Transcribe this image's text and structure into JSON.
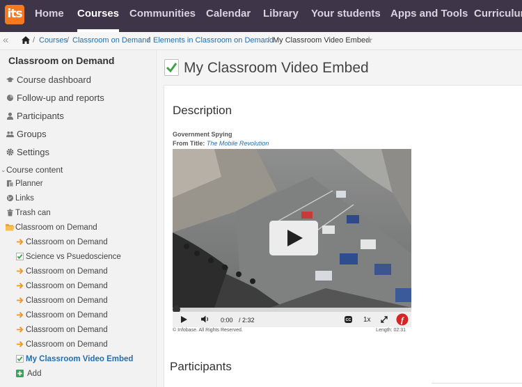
{
  "topnav": {
    "logo": "its",
    "items": [
      "Home",
      "Courses",
      "Communities",
      "Calendar",
      "Library",
      "Your students",
      "Apps and Tools",
      "Curriculum"
    ],
    "active": "Courses"
  },
  "breadcrumb": {
    "items": [
      "Courses",
      "Classroom on Demand",
      "Elements in Classroom on Demand"
    ],
    "current": "My Classroom Video Embed",
    "separator": "/"
  },
  "sidebar": {
    "title": "Classroom on Demand",
    "nav": [
      {
        "label": "Course dashboard",
        "icon": "graduation-cap-icon"
      },
      {
        "label": "Follow-up and reports",
        "icon": "pie-chart-icon"
      },
      {
        "label": "Participants",
        "icon": "person-icon"
      },
      {
        "label": "Groups",
        "icon": "group-icon"
      },
      {
        "label": "Settings",
        "icon": "gear-icon"
      }
    ],
    "course_content": "Course content",
    "tools": [
      {
        "label": "Planner",
        "icon": "planner-icon"
      },
      {
        "label": "Links",
        "icon": "globe-icon"
      },
      {
        "label": "Trash can",
        "icon": "trash-icon"
      }
    ],
    "folder": "Classroom on Demand",
    "children": [
      {
        "label": "Classroom on Demand",
        "icon": "arrow-right-icon"
      },
      {
        "label": "Science vs Psuedoscience",
        "icon": "checkbox-icon"
      },
      {
        "label": "Classroom on Demand",
        "icon": "arrow-right-icon"
      },
      {
        "label": "Classroom on Demand",
        "icon": "arrow-right-icon"
      },
      {
        "label": "Classroom on Demand",
        "icon": "arrow-right-icon"
      },
      {
        "label": "Classroom on Demand",
        "icon": "arrow-right-icon"
      },
      {
        "label": "Classroom on Demand",
        "icon": "arrow-right-icon"
      },
      {
        "label": "Classroom on Demand",
        "icon": "arrow-right-icon"
      },
      {
        "label": "My Classroom Video Embed",
        "icon": "checkbox-icon",
        "selected": true
      }
    ],
    "add": "Add"
  },
  "main": {
    "title": "My Classroom Video Embed",
    "description_heading": "Description",
    "video": {
      "title": "Government Spying",
      "from_label": "From Title:",
      "from_title": "The Mobile Revolution",
      "time_current": "0:00",
      "time_total": "/ 2:32",
      "speed": "1x",
      "copyright": "© Infobase. All Rights Reserved.",
      "length": "Length: 02:31",
      "progress": 0
    },
    "participants_heading": "Participants"
  },
  "colors": {
    "topnav_bg": "#3e3549",
    "logo_bg": "#f47920",
    "link": "#1f6fb2",
    "arrow_orange": "#f0951f",
    "check_green": "#3fa048",
    "add_green": "#3aa35a"
  }
}
